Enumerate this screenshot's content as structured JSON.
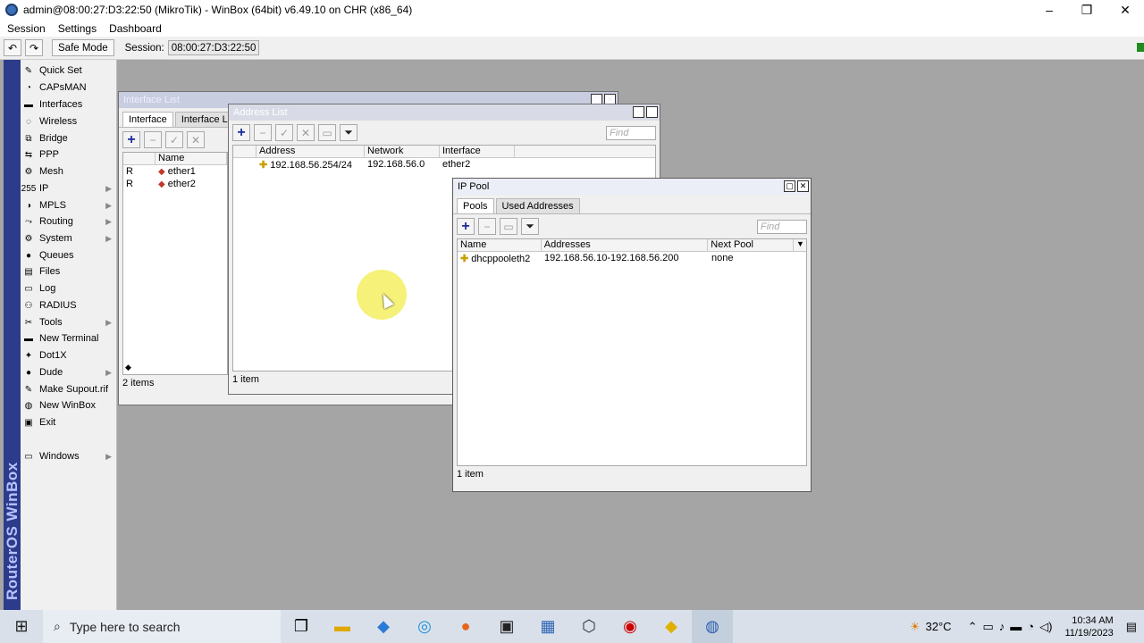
{
  "app": {
    "title": "admin@08:00:27:D3:22:50 (MikroTik) - WinBox (64bit) v6.49.10 on CHR (x86_64)",
    "window_controls": [
      "–",
      "❐",
      "✕"
    ]
  },
  "menu": [
    "Session",
    "Settings",
    "Dashboard"
  ],
  "toolbar": {
    "undo": "↶",
    "redo": "↷",
    "safe_mode": "Safe Mode",
    "session_label": "Session:",
    "session_value": "08:00:27:D3:22:50"
  },
  "sidebar": {
    "brand": "RouterOS WinBox",
    "items": [
      {
        "label": "Quick Set",
        "icon": "quickset-icon",
        "glyph": "✎",
        "submenu": false
      },
      {
        "label": "CAPsMAN",
        "icon": "capsman-icon",
        "glyph": "◔",
        "submenu": false
      },
      {
        "label": "Interfaces",
        "icon": "interfaces-icon",
        "glyph": "▬",
        "submenu": false
      },
      {
        "label": "Wireless",
        "icon": "wireless-icon",
        "glyph": "◌",
        "submenu": false
      },
      {
        "label": "Bridge",
        "icon": "bridge-icon",
        "glyph": "⧉",
        "submenu": false
      },
      {
        "label": "PPP",
        "icon": "ppp-icon",
        "glyph": "⇆",
        "submenu": false
      },
      {
        "label": "Mesh",
        "icon": "mesh-icon",
        "glyph": "⚙",
        "submenu": false
      },
      {
        "label": "IP",
        "icon": "ip-icon",
        "glyph": "255",
        "submenu": true
      },
      {
        "label": "MPLS",
        "icon": "mpls-icon",
        "glyph": "◑",
        "submenu": true
      },
      {
        "label": "Routing",
        "icon": "routing-icon",
        "glyph": "⤳",
        "submenu": true
      },
      {
        "label": "System",
        "icon": "system-icon",
        "glyph": "⚙",
        "submenu": true
      },
      {
        "label": "Queues",
        "icon": "queues-icon",
        "glyph": "●",
        "submenu": false
      },
      {
        "label": "Files",
        "icon": "files-icon",
        "glyph": "▤",
        "submenu": false
      },
      {
        "label": "Log",
        "icon": "log-icon",
        "glyph": "▭",
        "submenu": false
      },
      {
        "label": "RADIUS",
        "icon": "radius-icon",
        "glyph": "⚇",
        "submenu": false
      },
      {
        "label": "Tools",
        "icon": "tools-icon",
        "glyph": "✂",
        "submenu": true
      },
      {
        "label": "New Terminal",
        "icon": "terminal-icon",
        "glyph": "▬",
        "submenu": false
      },
      {
        "label": "Dot1X",
        "icon": "dot1x-icon",
        "glyph": "✦",
        "submenu": false
      },
      {
        "label": "Dude",
        "icon": "dude-icon",
        "glyph": "●",
        "submenu": true
      },
      {
        "label": "Make Supout.rif",
        "icon": "supout-icon",
        "glyph": "✎",
        "submenu": false
      },
      {
        "label": "New WinBox",
        "icon": "winbox-icon",
        "glyph": "◍",
        "submenu": false
      },
      {
        "label": "Exit",
        "icon": "exit-icon",
        "glyph": "▣",
        "submenu": false
      },
      {
        "label": "Windows",
        "icon": "windows-icon",
        "glyph": "▭",
        "submenu": true
      }
    ]
  },
  "interface_list": {
    "title": "Interface List",
    "tabs": [
      "Interface",
      "Interface List"
    ],
    "columns": [
      "",
      "Name"
    ],
    "rows": [
      {
        "flag": "R",
        "name": "ether1"
      },
      {
        "flag": "R",
        "name": "ether2"
      }
    ],
    "status": "2 items"
  },
  "address_list": {
    "title": "Address List",
    "find_placeholder": "Find",
    "columns": [
      "Address",
      "Network",
      "Interface"
    ],
    "rows": [
      {
        "address": "192.168.56.254/24",
        "network": "192.168.56.0",
        "interface": "ether2"
      }
    ],
    "status": "1 item"
  },
  "ip_pool": {
    "title": "IP Pool",
    "tabs": [
      "Pools",
      "Used Addresses"
    ],
    "find_placeholder": "Find",
    "columns": [
      "Name",
      "Addresses",
      "Next Pool"
    ],
    "rows": [
      {
        "name": "dhcppooleth2",
        "addresses": "192.168.56.10-192.168.56.200",
        "next_pool": "none"
      }
    ],
    "status": "1 item"
  },
  "taskbar": {
    "search_placeholder": "Type here to search",
    "weather": "32°C",
    "time": "10:34 AM",
    "date": "11/19/2023"
  }
}
